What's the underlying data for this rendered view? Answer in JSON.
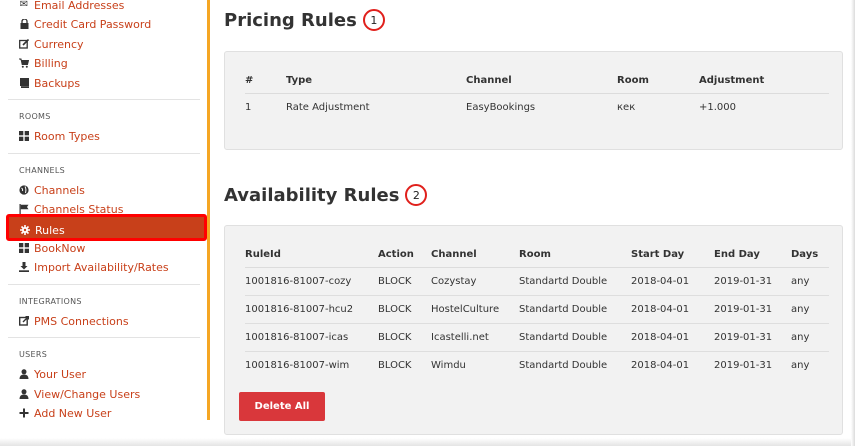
{
  "sidebar": {
    "top_items": [
      {
        "label": "Email Addresses",
        "icon": "envelope-icon"
      },
      {
        "label": "Credit Card Password",
        "icon": "lock-icon"
      },
      {
        "label": "Currency",
        "icon": "edit-icon"
      },
      {
        "label": "Billing",
        "icon": "cart-icon"
      },
      {
        "label": "Backups",
        "icon": "book-icon"
      }
    ],
    "rooms_heading": "ROOMS",
    "room_types": "Room Types",
    "channels_heading": "CHANNELS",
    "channels": "Channels",
    "channels_status": "Channels Status",
    "rules": "Rules",
    "booknow": "BookNow",
    "import": "Import Availability/Rates",
    "integrations_heading": "INTEGRATIONS",
    "pms": "PMS Connections",
    "users_heading": "USERS",
    "your_user": "Your User",
    "view_change_users": "View/Change Users",
    "add_new_user": "Add New User"
  },
  "pricing": {
    "title": "Pricing Rules",
    "badge": "1",
    "headers": [
      "#",
      "Type",
      "Channel",
      "Room",
      "Adjustment"
    ],
    "rows": [
      [
        "1",
        "Rate Adjustment",
        "EasyBookings",
        "кек",
        "+1.000"
      ]
    ]
  },
  "availability": {
    "title": "Availability Rules",
    "badge": "2",
    "headers": [
      "RuleId",
      "Action",
      "Channel",
      "Room",
      "Start Day",
      "End Day",
      "Days"
    ],
    "rows": [
      [
        "1001816-81007-cozy",
        "BLOCK",
        "Cozystay",
        "Standartd Double",
        "2018-04-01",
        "2019-01-31",
        "any"
      ],
      [
        "1001816-81007-hcu2",
        "BLOCK",
        "HostelCulture",
        "Standartd Double",
        "2018-04-01",
        "2019-01-31",
        "any"
      ],
      [
        "1001816-81007-icas",
        "BLOCK",
        "Icastelli.net",
        "Standartd Double",
        "2018-04-01",
        "2019-01-31",
        "any"
      ],
      [
        "1001816-81007-wim",
        "BLOCK",
        "Wimdu",
        "Standartd Double",
        "2018-04-01",
        "2019-01-31",
        "any"
      ]
    ],
    "delete_all": "Delete All"
  },
  "colors": {
    "accent": "#c8401a",
    "sidebar_border": "#f5a623",
    "highlight_box": "#ff0000",
    "delete_button": "#d9373b"
  }
}
